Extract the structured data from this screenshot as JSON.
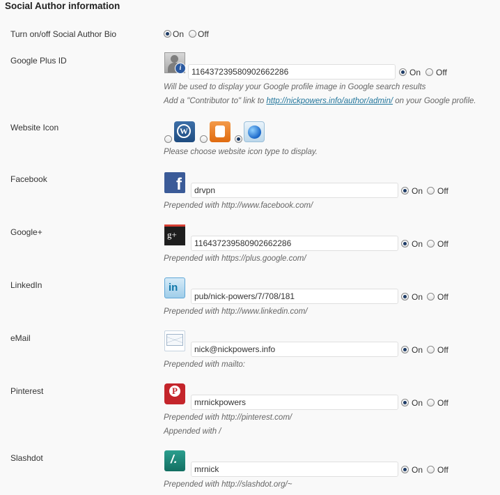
{
  "section_title": "Social Author information",
  "toggle_labels": {
    "on": "On",
    "off": "Off"
  },
  "bio": {
    "label": "Turn on/off Social Author Bio",
    "state": "on"
  },
  "google_plus_id": {
    "label": "Google Plus ID",
    "value": "116437239580902662286",
    "state": "on",
    "desc1": "Will be used to display your Google profile image in Google search results",
    "desc2_prefix": "Add a \"Contributor to\" link to ",
    "desc2_link": "http://nickpowers.info/author/admin/",
    "desc2_suffix": " on your Google profile."
  },
  "website_icon": {
    "label": "Website Icon",
    "options": [
      "wordpress-icon",
      "blogger-icon",
      "globe-icon"
    ],
    "selected": "globe-icon",
    "desc": "Please choose website icon type to display."
  },
  "networks": [
    {
      "key": "facebook",
      "label": "Facebook",
      "icon": "facebook-icon",
      "value": "drvpn",
      "state": "on",
      "desc": "Prepended with http://www.facebook.com/"
    },
    {
      "key": "googleplus",
      "label": "Google+",
      "icon": "google-plus-icon",
      "value": "116437239580902662286",
      "state": "on",
      "desc": "Prepended with https://plus.google.com/"
    },
    {
      "key": "linkedin",
      "label": "LinkedIn",
      "icon": "linkedin-icon",
      "value": "pub/nick-powers/7/708/181",
      "state": "on",
      "desc": "Prepended with http://www.linkedin.com/"
    },
    {
      "key": "email",
      "label": "eMail",
      "icon": "mail-icon",
      "value": "nick@nickpowers.info",
      "state": "on",
      "desc": "Prepended with mailto:"
    },
    {
      "key": "pinterest",
      "label": "Pinterest",
      "icon": "pinterest-icon",
      "value": "mrnickpowers",
      "state": "on",
      "desc": "Prepended with http://pinterest.com/",
      "desc2": "Appended with /"
    },
    {
      "key": "slashdot",
      "label": "Slashdot",
      "icon": "slashdot-icon",
      "value": "mrnick",
      "state": "on",
      "desc": "Prepended with http://slashdot.org/~"
    }
  ]
}
